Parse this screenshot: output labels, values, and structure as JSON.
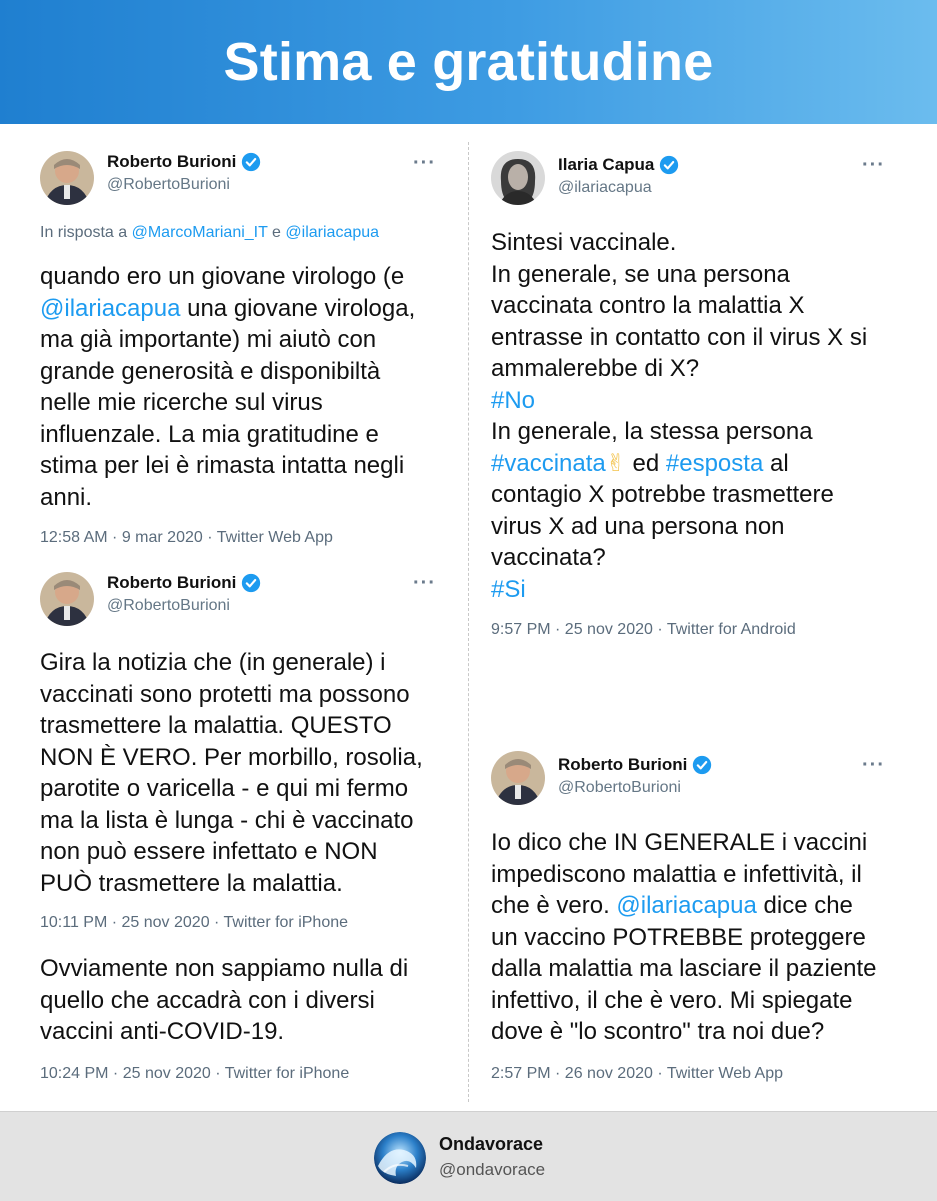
{
  "header": {
    "title": "Stima e gratitudine"
  },
  "tweets": {
    "t1": {
      "author": "Roberto Burioni",
      "handle": "@RobertoBurioni",
      "reply_prefix": "In risposta a",
      "reply_user1": "@MarcoMariani_IT",
      "reply_and": "e",
      "reply_user2": "@ilariacapua",
      "lines": {
        "l1": "quando ero un giovane virologo (e",
        "l2_mention": "@ilariacapua",
        "l2_rest": " una giovane virologa,",
        "l3": "ma già importante) mi aiutò con",
        "l4": "grande generosità e disponibiltà",
        "l5": "nelle mie ricerche sul virus",
        "l6": "influenzale. La mia gratitudine e",
        "l7": "stima per lei è rimasta intatta negli",
        "l8": "anni."
      },
      "meta": "12:58 AM · 9 mar 2020 · Twitter Web App"
    },
    "t2": {
      "author": "Roberto Burioni",
      "handle": "@RobertoBurioni",
      "lines": {
        "l1": "Gira la notizia che (in generale) i",
        "l2": "vaccinati sono protetti ma possono",
        "l3": "trasmettere la malattia. QUESTO",
        "l4": "NON È VERO. Per morbillo, rosolia,",
        "l5": "parotite o varicella - e qui mi fermo",
        "l6": "ma la lista è lunga - chi è vaccinato",
        "l7": "non può essere infettato e NON",
        "l8": "PUÒ trasmettere la malattia."
      },
      "meta": "10:11 PM · 25 nov 2020 · Twitter for iPhone",
      "followup": {
        "l1": "Ovviamente non sappiamo nulla di",
        "l2": "quello che accadrà con i diversi",
        "l3": "vaccini anti-COVID-19."
      },
      "followup_meta": "10:24 PM · 25 nov 2020 · Twitter for iPhone"
    },
    "t3": {
      "author": "Ilaria Capua",
      "handle": "@ilariacapua",
      "lines": {
        "l1": "Sintesi vaccinale.",
        "l2": "In generale, se una  persona",
        "l3": "vaccinata contro la malattia X",
        "l4": "entrasse in contatto con il virus X si",
        "l5": "ammalerebbe di X?",
        "l6": "#No",
        "l7": "In generale, la stessa persona",
        "l8_tag1": "#vaccinata",
        "l8_emoji": "✌",
        "l8_mid": " ed ",
        "l8_tag2": "#esposta",
        "l8_rest": " al",
        "l9": "contagio X potrebbe trasmettere",
        "l10": "virus X ad una persona non",
        "l11": "vaccinata?",
        "l12": "#Si"
      },
      "meta": "9:57 PM · 25 nov 2020 · Twitter for Android"
    },
    "t4": {
      "author": "Roberto Burioni",
      "handle": "@RobertoBurioni",
      "lines": {
        "l1": "Io dico che IN GENERALE i vaccini",
        "l2": "impediscono malattia e infettività, il",
        "l3_pre": "che è vero. ",
        "l3_mention": "@ilariacapua",
        "l3_rest": " dice che",
        "l4": "un vaccino POTREBBE proteggere",
        "l5": "dalla malattia ma lasciare il paziente",
        "l6": "infettivo, il che è vero. Mi spiegate",
        "l7": "dove è \"lo scontro\" tra noi due?"
      },
      "meta": "2:57 PM · 26 nov 2020 · Twitter Web App"
    }
  },
  "more_label": "···",
  "footer": {
    "name": "Ondavorace",
    "handle": "@ondavorace"
  },
  "colors": {
    "link": "#1d9bf0",
    "header_start": "#1f7fd0",
    "header_end": "#6bbcee",
    "verified": "#1d9bf0"
  },
  "icons": {
    "verified": "verified-badge-icon",
    "more": "more-options-icon"
  }
}
